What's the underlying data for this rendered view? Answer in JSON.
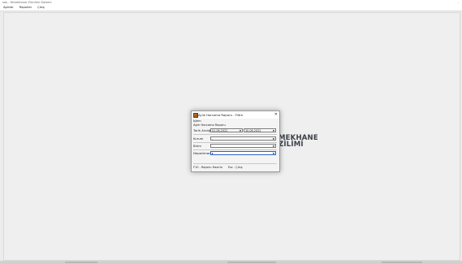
{
  "window": {
    "title": "sas - Yemekhane Zümlimi Sistemi",
    "min_label": "–"
  },
  "menubar": {
    "items": [
      "Ayarlar",
      "Raporlar",
      "Çıkış"
    ]
  },
  "brand_text": {
    "line1": "MEKHANE",
    "line2": "ZİLİMİ"
  },
  "dialog": {
    "title": "Aylık Harcama Raporu - Filtre",
    "close_label": "✕",
    "menu_label": "İşlem",
    "header_label": "Aylık Harcama Raporu",
    "date_label": "Tarih Aralığı",
    "date_from": "01.06.2022",
    "date_to": "30.06.2022",
    "kurum_label": "Kurum",
    "kurum_value": "-",
    "birim_label": "Birim",
    "birim_value": "",
    "departman_label": "Departman",
    "departman_value": "",
    "footer_report": "F10 - Raporu Hazırla",
    "footer_exit": "Esc - Çıkış"
  },
  "icons": {
    "dropdown": "chevron-down-icon",
    "close": "close-icon",
    "app": "report-icon"
  },
  "colors": {
    "accent": "#2a62c9",
    "brand_text": "#3a3e48"
  }
}
